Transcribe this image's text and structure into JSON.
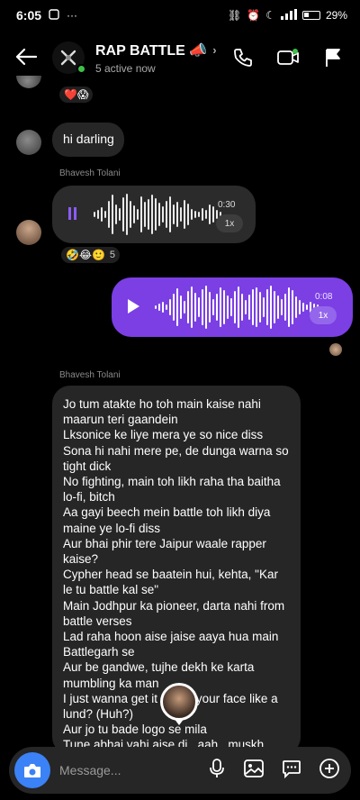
{
  "status_bar": {
    "time": "6:05",
    "battery": "29%"
  },
  "header": {
    "title": "RAP BATTLE 📣",
    "subtitle": "5 active now"
  },
  "messages": [
    {
      "type": "reaction_only",
      "reactions": "❤️😱"
    },
    {
      "type": "text",
      "text": "hi darling"
    },
    {
      "type": "voice",
      "sender": "Bhavesh Tolani",
      "duration": "0:30",
      "speed": "1x",
      "reactions": "🤣😂🙂",
      "reaction_count": "5"
    },
    {
      "type": "voice_outgoing",
      "duration": "0:08",
      "speed": "1x"
    },
    {
      "type": "long_text",
      "sender": "Bhavesh Tolani",
      "lines": [
        "Jo tum atakte ho toh main kaise nahi maarun teri gaandein",
        "Lksonice ke liye mera ye so nice diss",
        "Sona hi nahi mere pe, de dunga warna so tight dick",
        "No fighting, main toh likh raha tha baitha lo-fi, bitch",
        "Aa gayi beech mein battle toh likh diya maine ye lo-fi diss",
        "Aur bhai phir tere Jaipur waale rapper kaise?",
        "Cypher head se baatein hui, kehta, \"Kar le tu battle kal se\"",
        "Main Jodhpur ka pioneer, darta nahi from battle verses",
        "Lad raha hoon aise jaise aaya hua main Battlegarh se",
        "Aur be gandwe, tujhe dekh ke karta mumbling ka man",
        "I just wanna get it        r, why your face like a lund? (Huh?)",
        "Aur jo tu bade logo se mila",
        "Tune abhai yahi aise di...aah...muskh"
      ]
    }
  ],
  "composer": {
    "placeholder": "Message..."
  }
}
